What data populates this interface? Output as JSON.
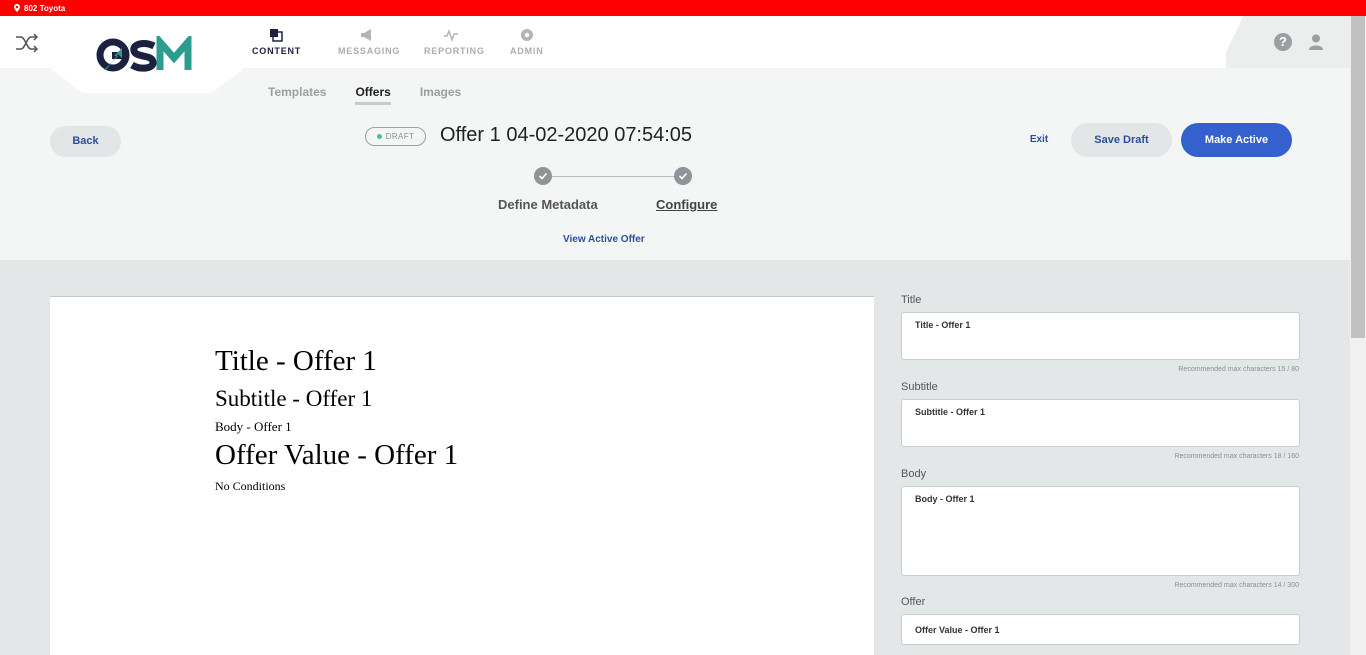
{
  "location": {
    "name": "802 Toyota"
  },
  "header": {
    "nav": [
      {
        "label": "CONTENT",
        "icon": "content-icon",
        "active": true
      },
      {
        "label": "MESSAGING",
        "icon": "megaphone-icon",
        "active": false
      },
      {
        "label": "REPORTING",
        "icon": "pulse-icon",
        "active": false
      },
      {
        "label": "ADMIN",
        "icon": "gear-icon",
        "active": false
      }
    ],
    "help": "?"
  },
  "subtabs": [
    {
      "label": "Templates",
      "active": false
    },
    {
      "label": "Offers",
      "active": true
    },
    {
      "label": "Images",
      "active": false
    }
  ],
  "toolbar": {
    "back_label": "Back",
    "status": "DRAFT",
    "title": "Offer 1 04-02-2020 07:54:05",
    "exit_label": "Exit",
    "save_label": "Save Draft",
    "make_active_label": "Make Active"
  },
  "steps": [
    {
      "label": "Define Metadata",
      "done": true
    },
    {
      "label": "Configure",
      "done": true,
      "current": true
    }
  ],
  "view_active_offer": "View Active Offer",
  "preview": {
    "title": "Title - Offer 1",
    "subtitle": "Subtitle - Offer 1",
    "body": "Body - Offer 1",
    "offer_value": "Offer Value - Offer 1",
    "conditions": "No Conditions"
  },
  "form": {
    "title": {
      "label": "Title",
      "value": "Title - Offer 1",
      "counter": "Recommended max characters 15 / 80"
    },
    "subtitle": {
      "label": "Subtitle",
      "value": "Subtitle - Offer 1",
      "counter": "Recommended max characters 18 / 160"
    },
    "body": {
      "label": "Body",
      "value": "Body - Offer 1",
      "counter": "Recommended max characters 14 / 300"
    },
    "offer": {
      "label": "Offer",
      "value": "Offer Value - Offer 1"
    }
  },
  "colors": {
    "alert_bar": "#ff0000",
    "primary": "#3561cf",
    "link": "#2d4e9a",
    "logo_dark": "#1d2140",
    "logo_teal": "#2a9d8f"
  }
}
